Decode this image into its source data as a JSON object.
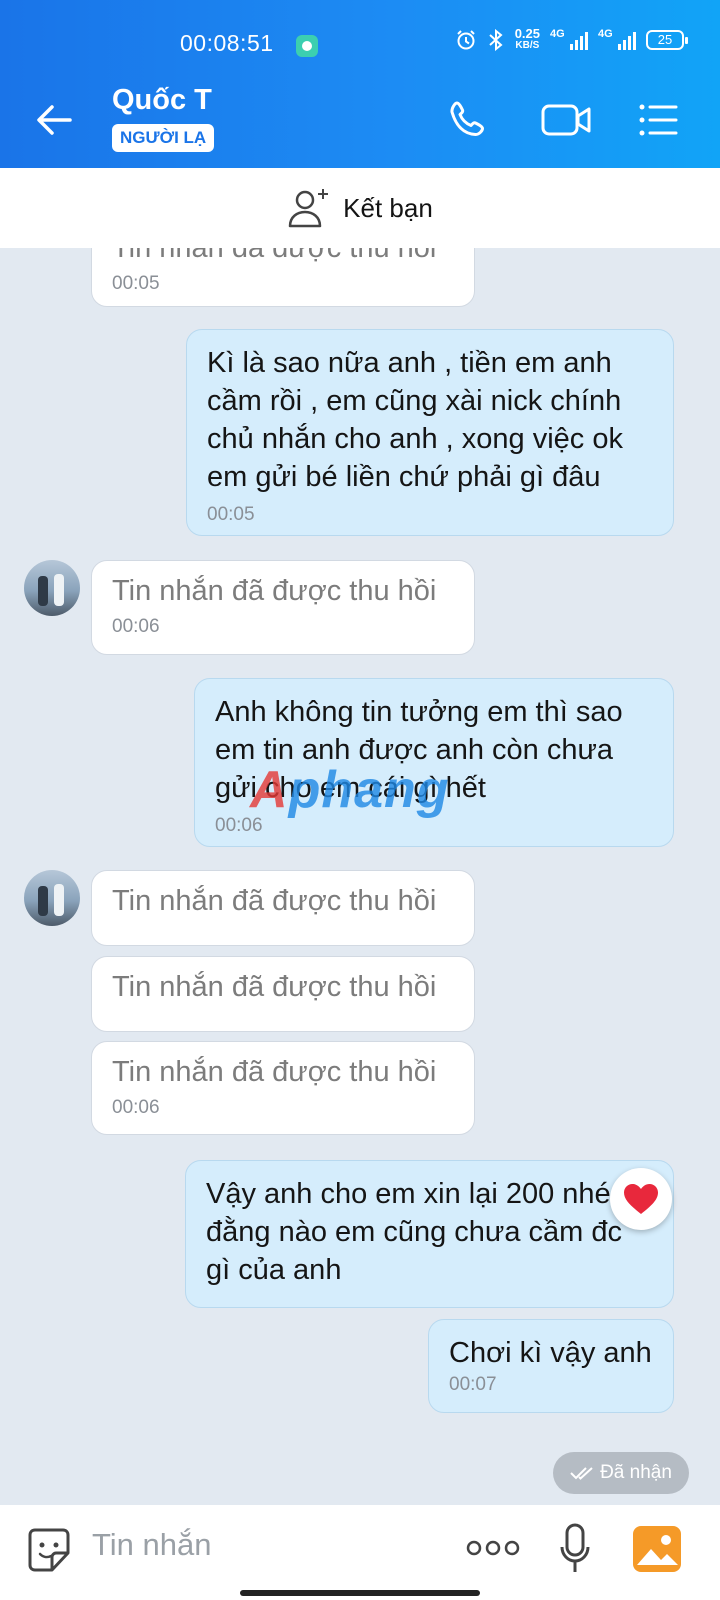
{
  "status_bar": {
    "time": "00:08:51",
    "speed_value": "0.25",
    "speed_unit": "KB/S",
    "network_1": "4G",
    "network_2": "4G",
    "battery": "25"
  },
  "header": {
    "contact_name": "Quốc T",
    "badge": "NGƯỜI LẠ"
  },
  "friend_bar": {
    "label": "Kết bạn"
  },
  "messages": [
    {
      "side": "in",
      "text": "Tin nhắn đã được thu hồi",
      "time": "00:05"
    },
    {
      "side": "out",
      "text": "Kì là sao nữa anh , tiền em anh cầm rồi , em cũng xài nick chính chủ nhắn cho anh , xong việc ok em gửi bé liền chứ phải gì đâu",
      "time": "00:05"
    },
    {
      "side": "in",
      "text": "Tin nhắn đã được thu hồi",
      "time": "00:06"
    },
    {
      "side": "out",
      "text": "Anh không tin tưởng em thì sao em tin anh được anh còn chưa gửi cho em cái gì hết",
      "time": "00:06"
    },
    {
      "side": "in",
      "text": "Tin nhắn đã được thu hồi"
    },
    {
      "side": "in",
      "text": "Tin nhắn đã được thu hồi"
    },
    {
      "side": "in",
      "text": "Tin nhắn đã được thu hồi",
      "time": "00:06"
    },
    {
      "side": "out",
      "text": "Vậy anh cho em xin lại 200 nhé , đằng nào em cũng chưa cầm đc gì của anh"
    },
    {
      "side": "out",
      "text": "Chơi kì vậy anh",
      "time": "00:07"
    }
  ],
  "watermark": {
    "part1": "A",
    "part2": "phang"
  },
  "reaction": {
    "icon": "heart-icon",
    "color": "#e8283c"
  },
  "delivery_status": "Đã nhận",
  "composer": {
    "placeholder": "Tin nhắn"
  },
  "colors": {
    "header_blue": "#1a74e8",
    "outgoing_bubble": "#d5edfc",
    "incoming_bubble": "#ffffff",
    "background": "#e2e9f1"
  }
}
